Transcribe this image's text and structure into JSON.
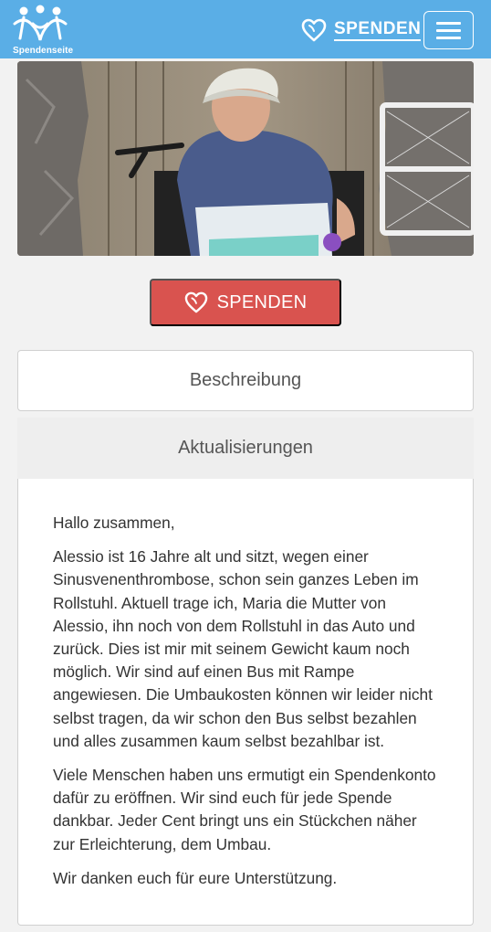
{
  "header": {
    "logo_text": "Spendenseite",
    "donate_label": "SPENDEN",
    "brand_color": "#5aaee6"
  },
  "icons": {
    "logo": "spendenseite-logo-icon",
    "heart": "heart-outline-icon",
    "menu": "hamburger-menu-icon"
  },
  "hero": {
    "alt": "Hero photo"
  },
  "main": {
    "donate_button_label": "SPENDEN",
    "donate_color": "#d9534f"
  },
  "tabs": [
    {
      "label": "Beschreibung"
    },
    {
      "label": "Aktualisierungen"
    }
  ],
  "content": {
    "paragraphs": [
      "Hallo zusammen,",
      "Alessio ist 16 Jahre alt und sitzt, wegen einer Sinusvenenthrombose, schon sein ganzes Leben im Rollstuhl. Aktuell trage ich, Maria die Mutter von Alessio, ihn noch von dem Rollstuhl in das Auto und zurück. Dies ist mir mit seinem Gewicht kaum noch möglich. Wir sind auf einen Bus mit Rampe angewiesen. Die Umbaukosten können wir leider nicht selbst tragen, da wir schon den Bus selbst bezahlen und alles zusammen kaum selbst bezahlbar ist.",
      "Viele Menschen haben uns ermutigt ein Spendenkonto dafür zu eröffnen. Wir sind euch für jede Spende dankbar. Jeder Cent bringt uns ein Stückchen näher zur Erleichterung, dem Umbau.",
      "Wir danken euch für eure Unterstützung."
    ]
  }
}
